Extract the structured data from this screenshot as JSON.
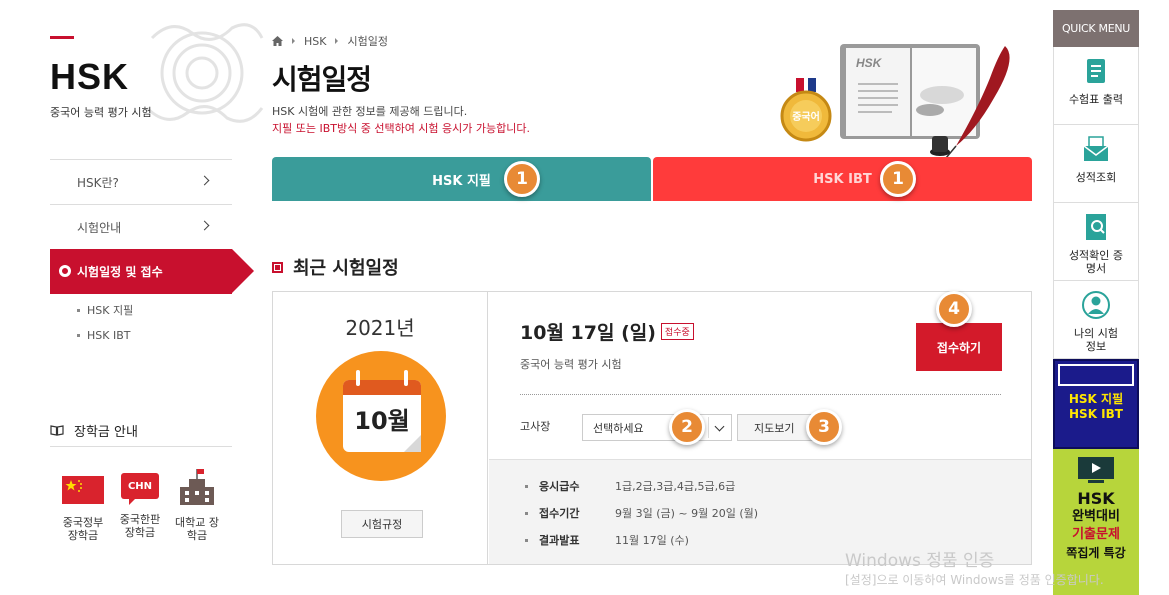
{
  "logo": {
    "text": "HSK",
    "subtitle": "중국어 능력 평가 시험"
  },
  "left_nav": {
    "items": [
      {
        "label": "HSK란?"
      },
      {
        "label": "시험안내"
      },
      {
        "label": "시험일정 및 접수"
      }
    ],
    "sub_items": [
      {
        "label": "HSK 지필"
      },
      {
        "label": "HSK IBT"
      }
    ]
  },
  "scholarship": {
    "title": "장학금 안내",
    "items": [
      {
        "label": "중국정부 장학금",
        "icon": "china-flag-icon"
      },
      {
        "label": "중국한판 장학금",
        "badge": "CHN",
        "icon": "chn-speech-bubble-icon"
      },
      {
        "label": "대학교 장학금",
        "icon": "university-building-icon"
      }
    ]
  },
  "breadcrumb": {
    "items": [
      "HSK",
      "시험일정"
    ]
  },
  "page": {
    "title": "시험일정",
    "description": "HSK 시험에 관한 정보를 제공해 드립니다.",
    "notice": "지필 또는 IBT방식 중 선택하여 시험 응시가 가능합니다."
  },
  "hero": {
    "medal_text": "중국어",
    "book_text": "HSK"
  },
  "tabs": [
    {
      "label": "HSK 지필",
      "badge": "1",
      "color": "#3a9c9a"
    },
    {
      "label": "HSK IBT",
      "badge": "1",
      "color": "#ff3b3b"
    }
  ],
  "section": {
    "title": "최근 시험일정"
  },
  "exam": {
    "year": "2021년",
    "month": "10월",
    "date": "10월 17일 (일)",
    "status": "접수중",
    "name": "중국어 능력 평가 시험",
    "apply_label": "접수하기",
    "apply_badge": "4",
    "rule_label": "시험규정",
    "venue_label": "고사장",
    "venue_select": "선택하세요",
    "venue_badge": "2",
    "map_label": "지도보기",
    "map_badge": "3",
    "info": [
      {
        "key": "응시급수",
        "value": "1급,2급,3급,4급,5급,6급"
      },
      {
        "key": "접수기간",
        "value": "9월 3일 (금) ~ 9월 20일 (월)"
      },
      {
        "key": "결과발표",
        "value": "11월 17일 (수)"
      }
    ]
  },
  "quick_menu": {
    "title": "QUICK MENU",
    "items": [
      {
        "label": "수험표 출력",
        "icon": "scroll-icon"
      },
      {
        "label": "성적조회",
        "icon": "envelope-icon"
      },
      {
        "label": "성적확인 증명서",
        "icon": "document-search-icon"
      },
      {
        "label": "나의 시험정보",
        "icon": "user-icon"
      }
    ],
    "banner1": {
      "line1": "HSK 지필",
      "line2": "HSK IBT"
    },
    "banner2": {
      "line1": "HSK",
      "line2": "완벽대비",
      "line3": "기출문제",
      "line4": "쪽집게 특강"
    }
  },
  "watermark": {
    "line1": "Windows 정품 인증",
    "line2": "[설정]으로 이동하여 Windows를 정품 인증합니다."
  },
  "colors": {
    "brand_red": "#c8102e",
    "teal": "#3a9c9a",
    "ibt_red": "#ff3b3b",
    "badge_orange": "#e88a35",
    "calendar_orange": "#f7931e"
  }
}
